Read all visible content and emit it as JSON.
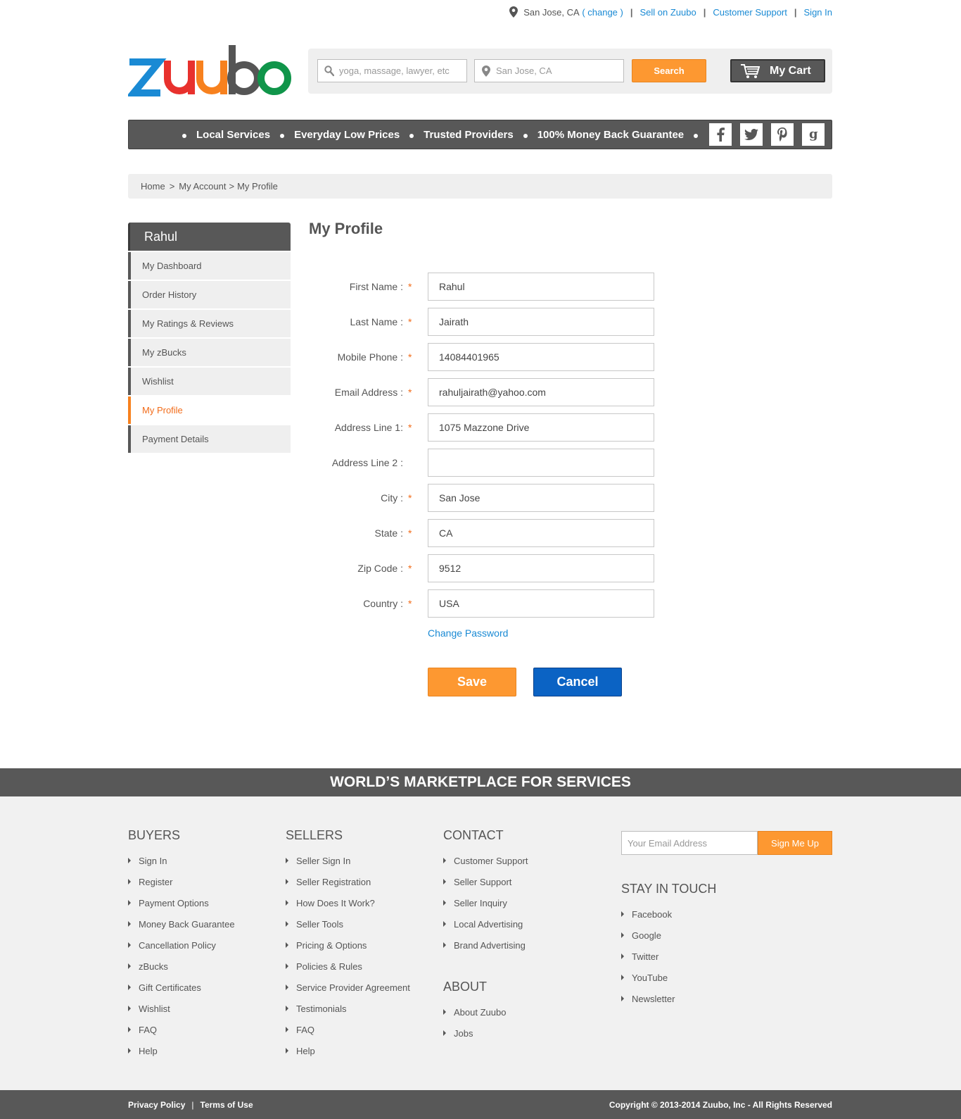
{
  "topbar": {
    "location": "San Jose, CA",
    "change_label": "( change )",
    "sell_label": "Sell on Zuubo",
    "support_label": "Customer Support",
    "signin_label": "Sign In"
  },
  "brand": {
    "name": "zuubo",
    "letters": [
      "z",
      "u",
      "u",
      "b",
      "o"
    ],
    "colors": [
      "#1a8ad4",
      "#e8312d",
      "#f7811e",
      "#555555",
      "#10954a"
    ]
  },
  "search": {
    "query_placeholder": "yoga, massage, lawyer, etc",
    "location_placeholder": "San Jose, CA",
    "button_label": "Search",
    "cart_label": "My Cart"
  },
  "nav": {
    "items": [
      "Local Services",
      "Everyday Low Prices",
      "Trusted Providers",
      "100% Money Back Guarantee"
    ],
    "socials": [
      {
        "name": "facebook-icon",
        "glyph": "f"
      },
      {
        "name": "twitter-icon",
        "glyph": ""
      },
      {
        "name": "pinterest-icon",
        "glyph": "P"
      },
      {
        "name": "google-icon",
        "glyph": "g"
      }
    ]
  },
  "breadcrumb": {
    "home": "Home",
    "sep1": ">",
    "account": "My Account",
    "sep2": ">",
    "current": "My Profile"
  },
  "sidebar": {
    "user": "Rahul",
    "items": [
      {
        "label": "My Dashboard",
        "active": false
      },
      {
        "label": "Order History",
        "active": false
      },
      {
        "label": "My Ratings & Reviews",
        "active": false
      },
      {
        "label": "My zBucks",
        "active": false
      },
      {
        "label": "Wishlist",
        "active": false
      },
      {
        "label": "My Profile",
        "active": true
      },
      {
        "label": "Payment Details",
        "active": false
      }
    ]
  },
  "profile": {
    "title": "My Profile",
    "fields": [
      {
        "label": "First Name :",
        "value": "Rahul",
        "required": true
      },
      {
        "label": "Last Name :",
        "value": "Jairath",
        "required": true
      },
      {
        "label": "Mobile Phone :",
        "value": "14084401965",
        "required": true
      },
      {
        "label": "Email Address :",
        "value": "rahuljairath@yahoo.com",
        "required": true
      },
      {
        "label": "Address Line 1:",
        "value": "1075 Mazzone Drive",
        "required": true
      },
      {
        "label": "Address Line 2 :",
        "value": "",
        "required": false
      },
      {
        "label": "City :",
        "value": "San Jose",
        "required": true
      },
      {
        "label": "State :",
        "value": "CA",
        "required": true
      },
      {
        "label": "Zip Code :",
        "value": "9512",
        "required": true
      },
      {
        "label": "Country :",
        "value": "USA",
        "required": true
      }
    ],
    "required_mark": "*",
    "change_password": "Change Password",
    "save_label": "Save",
    "cancel_label": "Cancel"
  },
  "footer": {
    "band": "WORLD’S MARKETPLACE FOR SERVICES",
    "buyers": {
      "title": "BUYERS",
      "links": [
        "Sign In",
        "Register",
        "Payment Options",
        "Money Back Guarantee",
        "Cancellation Policy",
        "zBucks",
        "Gift Certificates",
        "Wishlist",
        "FAQ",
        "Help"
      ]
    },
    "sellers": {
      "title": "SELLERS",
      "links": [
        "Seller Sign In",
        "Seller Registration",
        "How Does It Work?",
        "Seller Tools",
        "Pricing & Options",
        "Policies & Rules",
        "Service Provider Agreement",
        "Testimonials",
        "FAQ",
        "Help"
      ]
    },
    "contact": {
      "title": "CONTACT",
      "links": [
        "Customer Support",
        "Seller Support",
        "Seller Inquiry",
        "Local Advertising",
        "Brand Advertising"
      ]
    },
    "about": {
      "title": "ABOUT",
      "links": [
        "About Zuubo",
        "Jobs"
      ]
    },
    "newsletter": {
      "placeholder": "Your Email Address",
      "button": "Sign Me Up"
    },
    "stay": {
      "title": "STAY IN TOUCH",
      "links": [
        "Facebook",
        "Google",
        "Twitter",
        "YouTube",
        "Newsletter"
      ]
    },
    "privacy": "Privacy Policy",
    "pipe": "|",
    "terms": "Terms of Use",
    "copyright": "Copyright © 2013-2014 Zuubo, Inc - All Rights Reserved"
  },
  "colors": {
    "accent_orange": "#fd9831",
    "primary_blue": "#0b63c4",
    "link_blue": "#1a8ad4",
    "dark_gray": "#585858",
    "active_orange": "#f26c1a"
  }
}
